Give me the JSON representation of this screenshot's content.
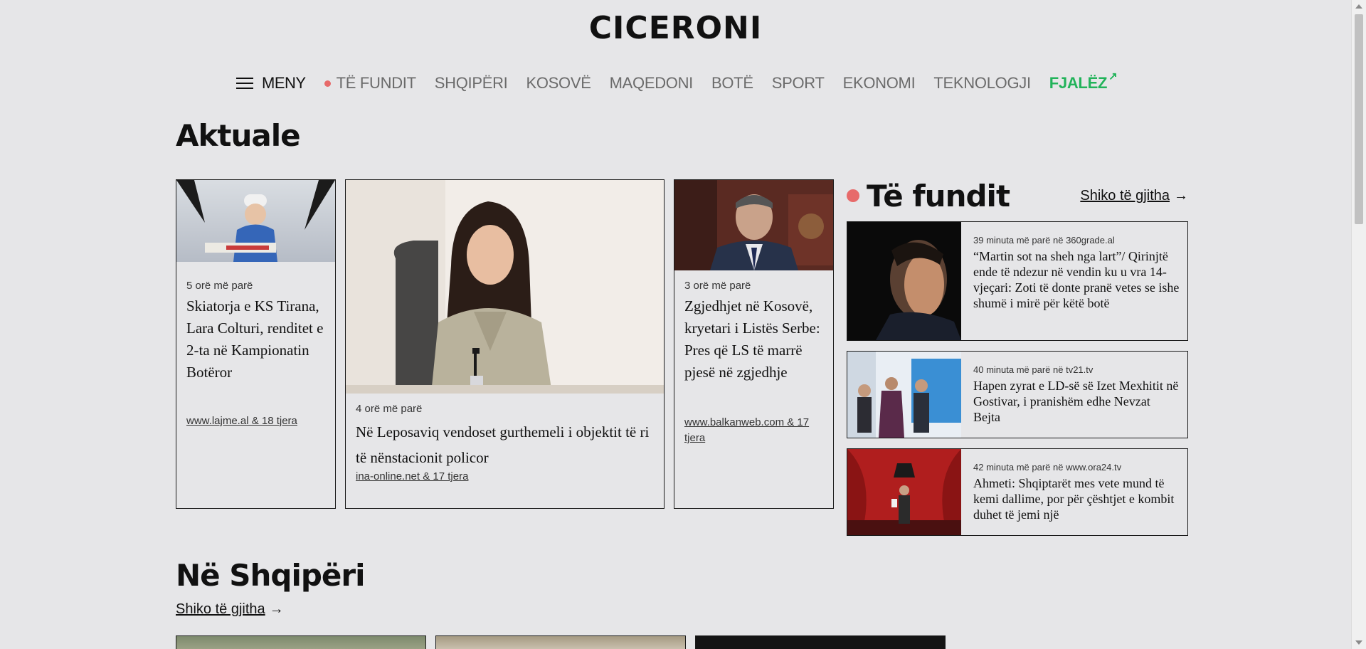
{
  "site": {
    "logo": "CICERONI"
  },
  "nav": {
    "menu_label": "MENY",
    "items": [
      {
        "label": "TË FUNDIT"
      },
      {
        "label": "SHQIPËRI"
      },
      {
        "label": "KOSOVË"
      },
      {
        "label": "MAQEDONI"
      },
      {
        "label": "BOTË"
      },
      {
        "label": "SPORT"
      },
      {
        "label": "EKONOMI"
      },
      {
        "label": "TEKNOLOGJI"
      },
      {
        "label": "FJALËZ"
      }
    ]
  },
  "aktuale": {
    "title": "Aktuale",
    "cards": [
      {
        "meta": "5 orë më parë",
        "headline": "Skiatorja e KS Tirana, Lara Colturi, renditet e 2-ta në Kampionatin Botëror",
        "source": "www.lajme.al & 18 tjera"
      },
      {
        "meta": "4 orë më parë",
        "headline": "Në Leposaviq vendoset gurthemeli i objektit të ri të nënstacionit policor",
        "source": "ina-online.net & 17 tjera"
      },
      {
        "meta": "3 orë më parë",
        "headline": "Zgjedhjet në Kosovë, kryetari i Listës Serbe: Pres që LS të marrë pjesë në zgjedhje",
        "source": "www.balkanweb.com & 17 tjera"
      }
    ]
  },
  "latest": {
    "title": "Të fundit",
    "see_all": "Shiko të gjitha",
    "items": [
      {
        "meta": "39 minuta më parë në 360grade.al",
        "headline": "“Martin sot na sheh nga lart”/ Qirinjtë ende të ndezur në vendin ku u vra 14-vjeçari: Zoti të donte pranë vetes se ishe shumë i mirë për këtë botë"
      },
      {
        "meta": "40 minuta më parë në tv21.tv",
        "headline": "Hapen zyrat e LD-së së Izet Mexhitit në Gostivar, i pranishëm edhe Nevzat Bejta"
      },
      {
        "meta": "42 minuta më parë në www.ora24.tv",
        "headline": "Ahmeti: Shqiptarët mes vete mund të kemi dallime, por për çështjet e kombit duhet të jemi një"
      }
    ]
  },
  "albania": {
    "title": "Në Shqipëri",
    "see_all": "Shiko të gjitha"
  },
  "colors": {
    "accent_red": "#e76a6a",
    "accent_green": "#22b35a",
    "background": "#e6e6e8"
  },
  "icons": [
    "hamburger-icon",
    "live-dot-icon",
    "external-arrow-icon",
    "right-arrow-icon"
  ]
}
